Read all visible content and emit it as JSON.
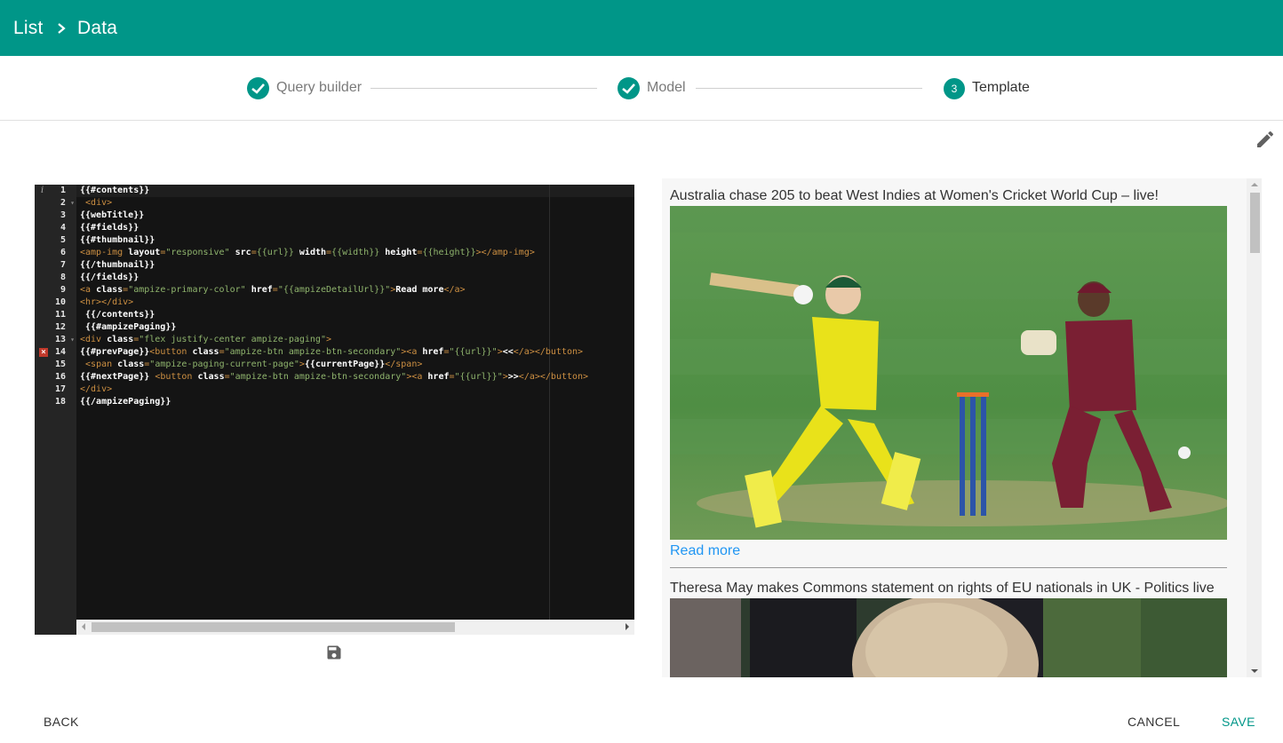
{
  "header": {
    "breadcrumb": [
      "List",
      "Data"
    ],
    "background_color": "#009688"
  },
  "stepper": {
    "steps": [
      {
        "label": "Query builder",
        "state": "done",
        "icon": "check-icon"
      },
      {
        "label": "Model",
        "state": "done",
        "icon": "check-icon"
      },
      {
        "label": "Template",
        "state": "active",
        "number": "3"
      }
    ]
  },
  "toolbar": {
    "edit_icon": "pencil-icon",
    "save_icon": "floppy-disk-icon"
  },
  "editor": {
    "line_numbers": [
      "1",
      "2",
      "3",
      "4",
      "5",
      "6",
      "7",
      "8",
      "9",
      "10",
      "11",
      "12",
      "13",
      "14",
      "15",
      "16",
      "17",
      "18"
    ],
    "info_marker_line": "1",
    "error_marker_line": "14",
    "fold_lines": [
      "2",
      "13"
    ],
    "lines": [
      [
        [
          "mus",
          "{{#contents}}"
        ]
      ],
      [
        [
          "txt",
          " "
        ],
        [
          "tag",
          "<div>"
        ]
      ],
      [
        [
          "mus",
          "{{webTitle}}"
        ]
      ],
      [
        [
          "mus",
          "{{#fields}}"
        ]
      ],
      [
        [
          "mus",
          "{{#thumbnail}}"
        ]
      ],
      [
        [
          "tag",
          "<amp-img "
        ],
        [
          "attr",
          "layout"
        ],
        [
          "tag",
          "="
        ],
        [
          "str",
          "\"responsive\""
        ],
        [
          "tag",
          " "
        ],
        [
          "attr",
          "src"
        ],
        [
          "tag",
          "="
        ],
        [
          "str",
          "{{url}}"
        ],
        [
          "tag",
          " "
        ],
        [
          "attr",
          "width"
        ],
        [
          "tag",
          "="
        ],
        [
          "str",
          "{{width}}"
        ],
        [
          "tag",
          " "
        ],
        [
          "attr",
          "height"
        ],
        [
          "tag",
          "="
        ],
        [
          "str",
          "{{height}}"
        ],
        [
          "tag",
          "></amp-img>"
        ]
      ],
      [
        [
          "mus",
          "{{/thumbnail}}"
        ]
      ],
      [
        [
          "mus",
          "{{/fields}}"
        ]
      ],
      [
        [
          "tag",
          "<a "
        ],
        [
          "attr",
          "class"
        ],
        [
          "tag",
          "="
        ],
        [
          "str",
          "\"ampize-primary-color\""
        ],
        [
          "tag",
          " "
        ],
        [
          "attr",
          "href"
        ],
        [
          "tag",
          "="
        ],
        [
          "str",
          "\"{{ampizeDetailUrl}}\""
        ],
        [
          "tag",
          ">"
        ],
        [
          "txt",
          "Read more"
        ],
        [
          "tag",
          "</a>"
        ]
      ],
      [
        [
          "tag",
          "<hr></div>"
        ]
      ],
      [
        [
          "mus",
          " {{/contents}}"
        ]
      ],
      [
        [
          "mus",
          " {{#ampizePaging}}"
        ]
      ],
      [
        [
          "tag",
          "<div "
        ],
        [
          "attr",
          "class"
        ],
        [
          "tag",
          "="
        ],
        [
          "str",
          "\"flex justify-center ampize-paging\""
        ],
        [
          "tag",
          ">"
        ]
      ],
      [
        [
          "mus",
          "{{#prevPage}}"
        ],
        [
          "tag",
          "<button "
        ],
        [
          "attr",
          "class"
        ],
        [
          "tag",
          "="
        ],
        [
          "str",
          "\"ampize-btn ampize-btn-secondary\""
        ],
        [
          "tag",
          "><a "
        ],
        [
          "attr",
          "href"
        ],
        [
          "tag",
          "="
        ],
        [
          "str",
          "\"{{url}}\""
        ],
        [
          "tag",
          ">"
        ],
        [
          "txt",
          "<<"
        ],
        [
          "tag",
          "</a></button>"
        ]
      ],
      [
        [
          "txt",
          " "
        ],
        [
          "tag",
          "<span "
        ],
        [
          "attr",
          "class"
        ],
        [
          "tag",
          "="
        ],
        [
          "str",
          "\"ampize-paging-current-page\""
        ],
        [
          "tag",
          ">"
        ],
        [
          "mus",
          "{{currentPage}}"
        ],
        [
          "tag",
          "</span>"
        ]
      ],
      [
        [
          "mus",
          "{{#nextPage}}"
        ],
        [
          "txt",
          " "
        ],
        [
          "tag",
          "<button "
        ],
        [
          "attr",
          "class"
        ],
        [
          "tag",
          "="
        ],
        [
          "str",
          "\"ampize-btn ampize-btn-secondary\""
        ],
        [
          "tag",
          "><a "
        ],
        [
          "attr",
          "href"
        ],
        [
          "tag",
          "="
        ],
        [
          "str",
          "\"{{url}}\""
        ],
        [
          "tag",
          ">"
        ],
        [
          "txt",
          ">>"
        ],
        [
          "tag",
          "</a></button>"
        ]
      ],
      [
        [
          "tag",
          "</div>"
        ]
      ],
      [
        [
          "mus",
          "{{/ampizePaging}}"
        ]
      ]
    ]
  },
  "preview": {
    "articles": [
      {
        "title": "Australia chase 205 to beat West Indies at Women's Cricket World Cup – live!",
        "image": "cricket-photo",
        "read_more": "Read more"
      },
      {
        "title": "Theresa May makes Commons statement on rights of EU nationals in UK - Politics live",
        "image": "politics-photo"
      }
    ]
  },
  "footer": {
    "back_label": "BACK",
    "cancel_label": "CANCEL",
    "save_label": "SAVE",
    "save_color": "#009688"
  }
}
